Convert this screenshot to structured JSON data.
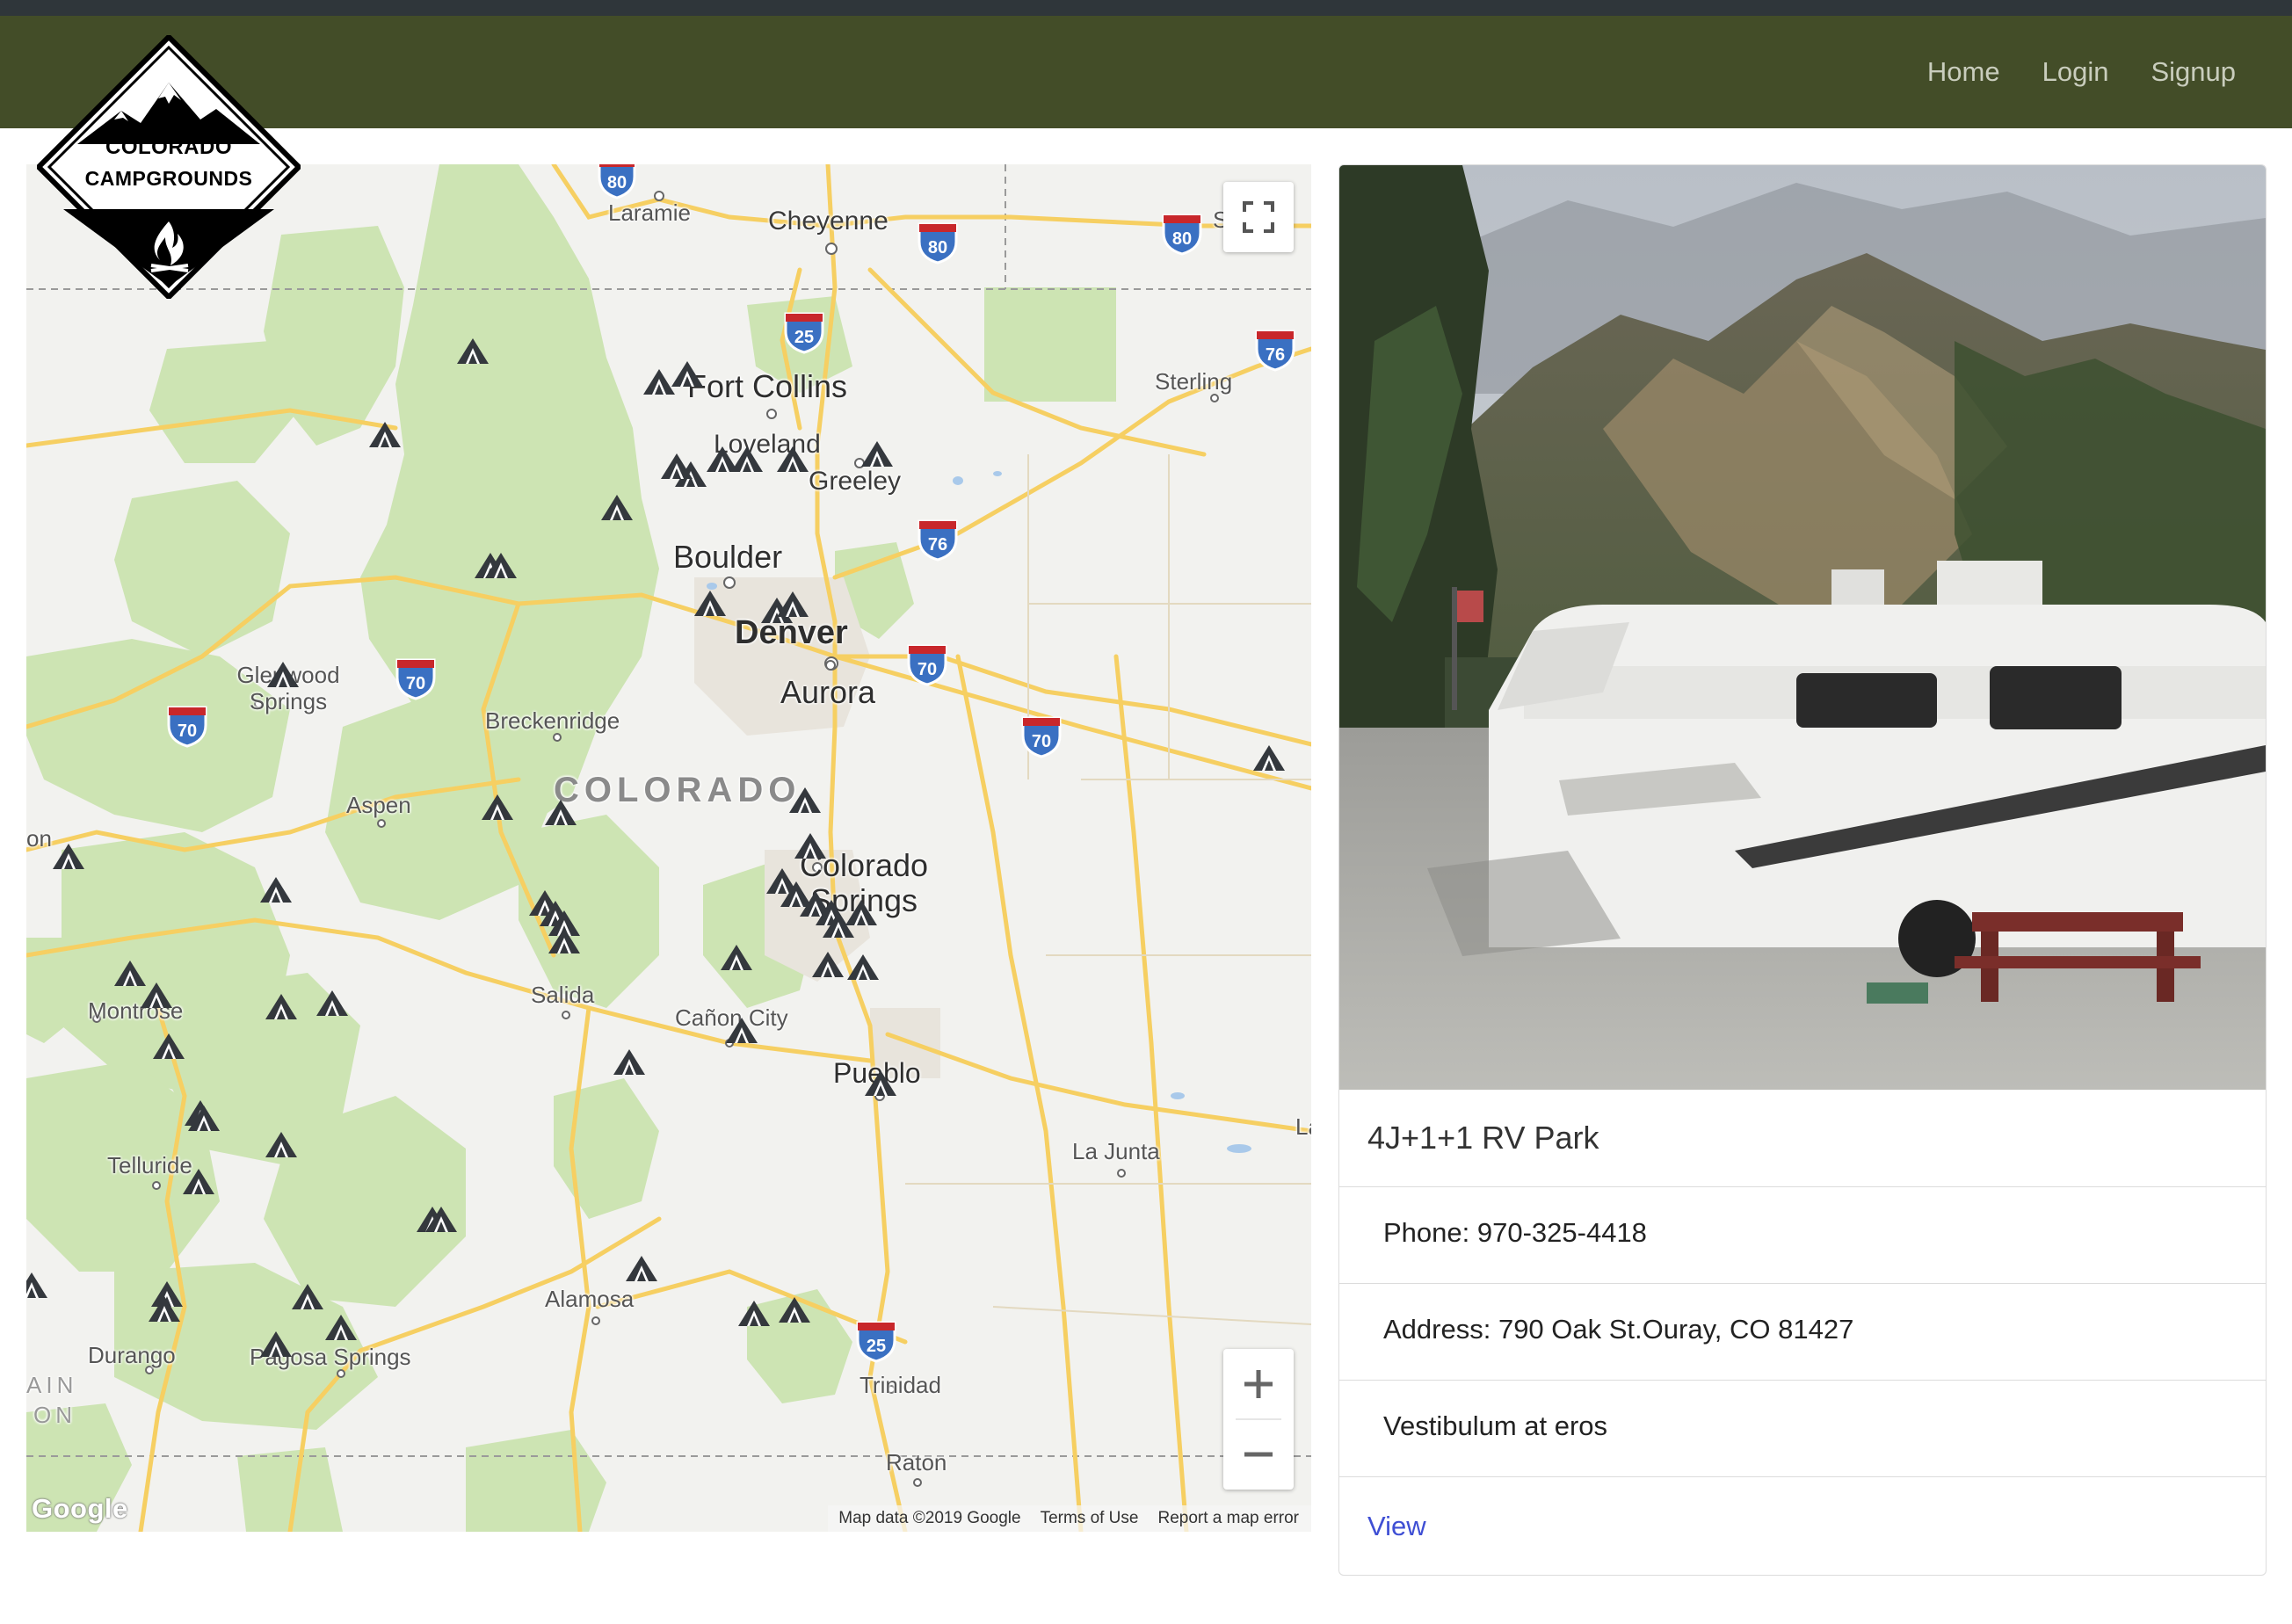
{
  "nav": {
    "links": [
      {
        "label": "Home"
      },
      {
        "label": "Login"
      },
      {
        "label": "Signup"
      }
    ]
  },
  "logo": {
    "line1": "COLORADO",
    "line2": "CAMPGROUNDS"
  },
  "map": {
    "state_label": "COLORADO",
    "places": {
      "laramie": "Laramie",
      "cheyenne": "Cheyenne",
      "sterling": "Sterling",
      "fort_collins": "Fort Collins",
      "loveland": "Loveland",
      "greeley": "Greeley",
      "boulder": "Boulder",
      "denver": "Denver",
      "aurora": "Aurora",
      "glenwood_springs": "Glenwood Springs",
      "breckenridge": "Breckenridge",
      "aspen": "Aspen",
      "colorado_springs": "Colorado Springs",
      "salida": "Salida",
      "montrose": "Montrose",
      "canon_city": "Cañon City",
      "pueblo": "Pueblo",
      "la_junta": "La Junta",
      "telluride": "Telluride",
      "alamosa": "Alamosa",
      "durango": "Durango",
      "pagosa_springs": "Pagosa Springs",
      "trinidad": "Trinidad",
      "raton": "Raton",
      "edge_s": "S",
      "edge_la": "La",
      "edge_on": "on",
      "edge_ain": "AIN",
      "edge_on2": "ON"
    },
    "highways": {
      "i25": "25",
      "i70": "70",
      "i76": "76",
      "i80": "80"
    },
    "footer": {
      "map_data": "Map data ©2019 Google",
      "terms": "Terms of Use",
      "report": "Report a map error"
    },
    "google_logo": "Google",
    "controls": {
      "zoom_in": "+",
      "zoom_out": "−"
    },
    "campground_marker_count": 60
  },
  "card": {
    "title": "4J+1+1 RV Park",
    "items": [
      {
        "text": "Phone: 970-325-4418"
      },
      {
        "text": "Address: 790 Oak St.Ouray, CO 81427"
      },
      {
        "text": "Vestibulum at eros"
      }
    ],
    "link": "View"
  },
  "colors": {
    "navbar": "#434d28",
    "top_strip": "#2f363a",
    "nav_link": "#c9cdbd",
    "park_green": "#cfe5b5",
    "road": "#f7d26b",
    "interstate_shield": "#3a70c2",
    "link": "#3f4fd4"
  }
}
